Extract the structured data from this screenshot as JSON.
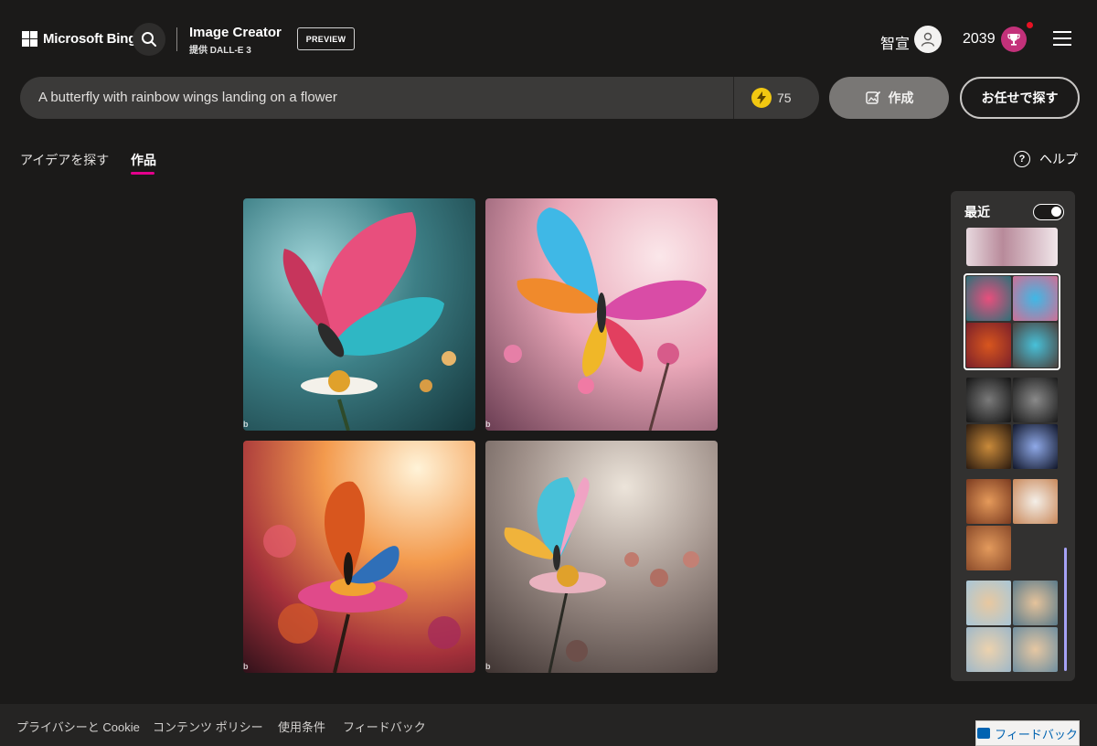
{
  "header": {
    "brand": "Microsoft Bing",
    "app_title": "Image Creator",
    "app_subtitle": "提供 DALL-E 3",
    "preview_badge": "PREVIEW",
    "user_name": "智宣",
    "points": "2039"
  },
  "prompt": {
    "value": "A butterfly with rainbow wings landing on a flower",
    "boosts": "75",
    "create_label": "作成",
    "surprise_label": "お任せで探す"
  },
  "tabs": {
    "explore": "アイデアを探す",
    "creations": "作品",
    "help": "ヘルプ"
  },
  "images": [
    {
      "mark": "b"
    },
    {
      "mark": "b"
    },
    {
      "mark": "b"
    },
    {
      "mark": "b"
    }
  ],
  "recent": {
    "title": "最近",
    "toggle_on": true
  },
  "footer": {
    "privacy": "プライバシーと Cookie",
    "content_policy": "コンテンツ ポリシー",
    "terms": "使用条件",
    "feedback": "フィードバック",
    "feedback_button": "フィードバック"
  },
  "colors": {
    "background": "#1b1a19",
    "accent_pink": "#e3008c",
    "trophy": "#c3317a",
    "boost_gold": "#f2c811",
    "scroll_thumb": "#a6a2f5"
  }
}
